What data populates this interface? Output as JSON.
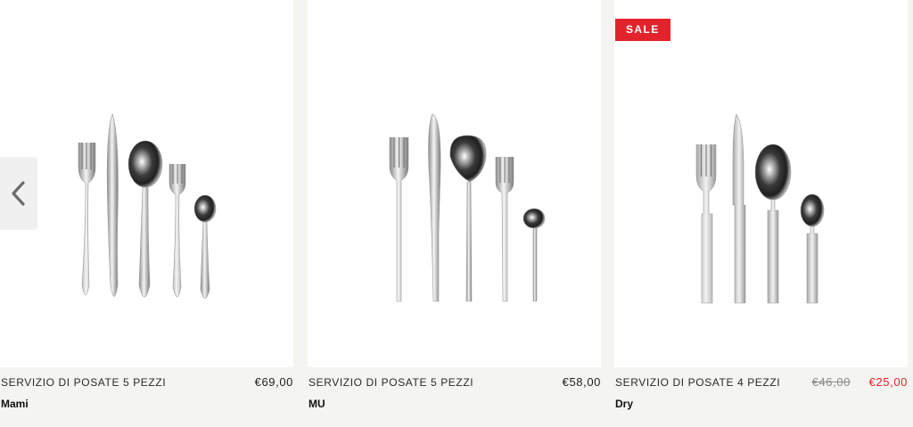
{
  "carousel": {
    "prev_icon": "chevron-left-icon",
    "products": [
      {
        "subtitle": "SERVIZIO DI POSATE 5 PEZZI",
        "name": "Mami",
        "price": "€69,00",
        "image_icon": "cutlery-set-icon"
      },
      {
        "subtitle": "SERVIZIO DI POSATE 5 PEZZI",
        "name": "MU",
        "price": "€58,00",
        "image_icon": "cutlery-set-icon"
      },
      {
        "subtitle": "SERVIZIO DI POSATE 4 PEZZI",
        "name": "Dry",
        "badge": "SALE",
        "price_old": "€46,00",
        "price": "€25,00",
        "image_icon": "cutlery-set-icon"
      }
    ]
  },
  "colors": {
    "background": "#f4f4f0",
    "card": "#ffffff",
    "sale": "#e3232c",
    "text": "#1e1e1e"
  }
}
